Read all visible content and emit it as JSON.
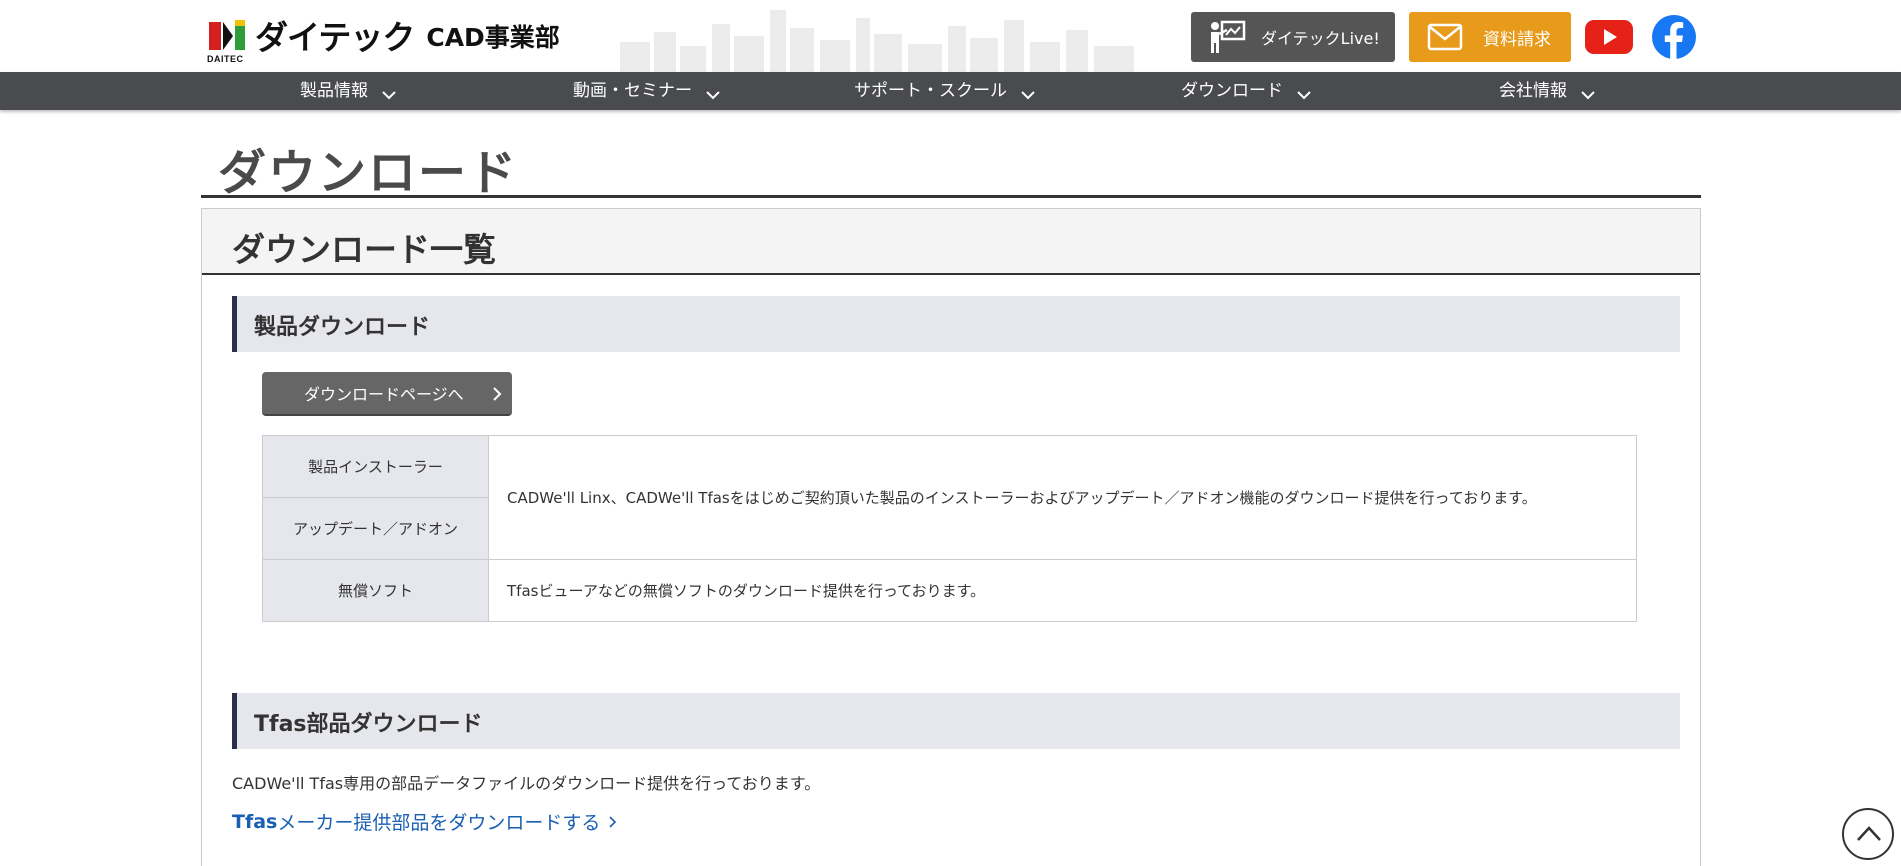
{
  "header": {
    "logo_text": "ダイテック",
    "logo_sub": "CAD事業部",
    "logo_small": "DAITEC",
    "live_button": "ダイテックLive!",
    "request_button": "資料請求",
    "youtube_icon": "youtube-icon",
    "facebook_icon": "facebook-icon"
  },
  "nav": {
    "items": [
      {
        "label": "製品情報"
      },
      {
        "label": "動画・セミナー"
      },
      {
        "label": "サポート・スクール"
      },
      {
        "label": "ダウンロード"
      },
      {
        "label": "会社情報"
      }
    ]
  },
  "page": {
    "title": "ダウンロード",
    "panel_title": "ダウンロード一覧"
  },
  "section_products": {
    "heading": "製品ダウンロード",
    "button": "ダウンロードページへ",
    "rows": [
      {
        "key": "製品インストーラー"
      },
      {
        "key": "アップデート／アドオン"
      },
      {
        "key": "無償ソフト",
        "value": "Tfasビューアなどの無償ソフトのダウンロード提供を行っております。"
      }
    ],
    "merged_value": "CADWe'll Linx、CADWe'll Tfasをはじめご契約頂いた製品のインストーラーおよびアップデート／アドオン機能のダウンロード提供を行っております。"
  },
  "section_tfas": {
    "heading": "Tfas部品ダウンロード",
    "text": "CADWe'll Tfas専用の部品データファイルのダウンロード提供を行っております。",
    "link_bold": "Tfas",
    "link_rest": "メーカー提供部品をダウンロードする"
  },
  "colors": {
    "nav_bg": "#4a4b4e",
    "live_bg": "#555555",
    "request_bg": "#e89a1b",
    "section_accent": "#2b2f4a",
    "link": "#1a5fb4"
  }
}
